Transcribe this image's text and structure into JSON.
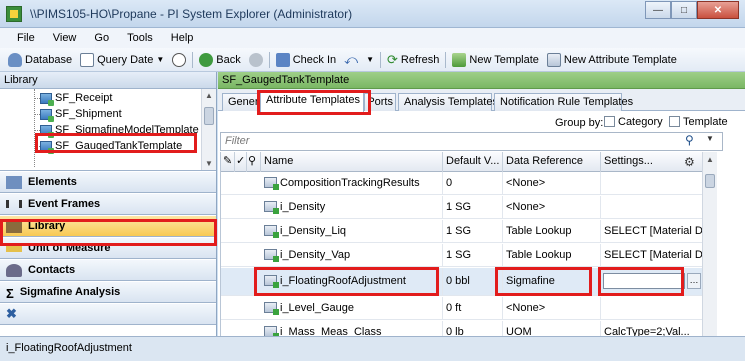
{
  "window": {
    "title": "\\\\PIMS105-HO\\Propane - PI System Explorer (Administrator)"
  },
  "menu": [
    "File",
    "View",
    "Go",
    "Tools",
    "Help"
  ],
  "toolbar": {
    "database": "Database",
    "query_date": "Query Date",
    "back": "Back",
    "check_in": "Check In",
    "refresh": "Refresh",
    "new_template": "New Template",
    "new_attribute_template": "New Attribute Template"
  },
  "left_panel": {
    "header": "Library",
    "tree": [
      "SF_Receipt",
      "SF_Shipment",
      "SF_SigmafineModelTemplate",
      "SF_GaugedTankTemplate"
    ],
    "nav": [
      "Elements",
      "Event Frames",
      "Library",
      "Unit of Measure",
      "Contacts",
      "Sigmafine Analysis"
    ]
  },
  "right_panel": {
    "header": "SF_GaugedTankTemplate",
    "tabs": [
      "General",
      "Attribute Templates",
      "Ports",
      "Analysis Templates",
      "Notification Rule Templates"
    ],
    "group_by": "Group by:",
    "category": "Category",
    "template": "Template",
    "filter_placeholder": "Filter"
  },
  "grid": {
    "columns": [
      "Name",
      "Default V...",
      "Data Reference",
      "Settings..."
    ],
    "rows": [
      {
        "name": "CompositionTrackingResults",
        "default": "0",
        "data_ref": "<None>",
        "settings": ""
      },
      {
        "name": "i_Density",
        "default": "1 SG",
        "data_ref": "<None>",
        "settings": ""
      },
      {
        "name": "i_Density_Liq",
        "default": "1 SG",
        "data_ref": "Table Lookup",
        "settings": "SELECT [Material D..."
      },
      {
        "name": "i_Density_Vap",
        "default": "1 SG",
        "data_ref": "Table Lookup",
        "settings": "SELECT [Material D..."
      },
      {
        "name": "i_FloatingRoofAdjustment",
        "default": "0 bbl",
        "data_ref": "Sigmafine",
        "settings": ""
      },
      {
        "name": "i_Level_Gauge",
        "default": "0 ft",
        "data_ref": "<None>",
        "settings": ""
      },
      {
        "name": "i_Mass_Meas_Class",
        "default": "0 lb",
        "data_ref": "UOM",
        "settings": "CalcType=2;Val..."
      }
    ]
  },
  "status_bar": "i_FloatingRoofAdjustment",
  "colors": {
    "highlight": "#e21c1c",
    "header_green": "#7ab764",
    "selected_nav": "#f8c952"
  }
}
